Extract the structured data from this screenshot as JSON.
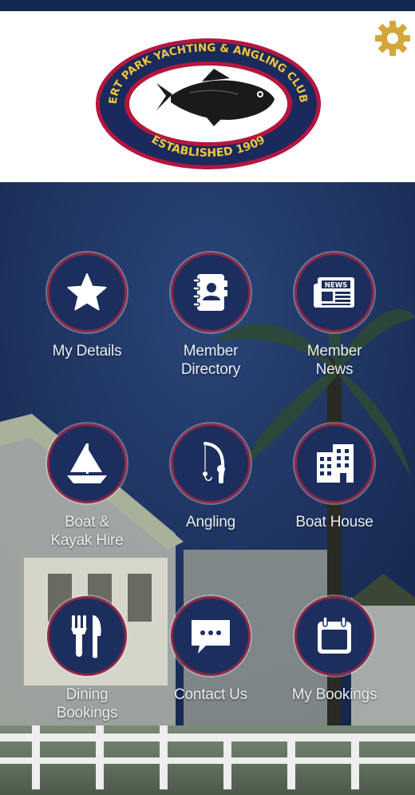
{
  "header": {
    "settings_icon": "gear-icon",
    "logo": {
      "top_text": "ALBERT PARK YACHTING & ANGLING CLUB INC",
      "bottom_text": "ESTABLISHED 1909"
    }
  },
  "colors": {
    "top_bar": "#152850",
    "gear": "#d4a63a",
    "circle_fill": "#1c2e5e",
    "circle_ring": "#8c2746"
  },
  "menu": {
    "tiles": [
      {
        "label": "My Details",
        "icon": "star-icon"
      },
      {
        "label": "Member\nDirectory",
        "icon": "address-book-icon"
      },
      {
        "label": "Member\nNews",
        "icon": "newspaper-icon"
      },
      {
        "label": "Boat &\nKayak Hire",
        "icon": "sailboat-icon"
      },
      {
        "label": "Angling",
        "icon": "fishing-rod-icon"
      },
      {
        "label": "Boat House",
        "icon": "building-icon"
      },
      {
        "label": "Dining\nBookings",
        "icon": "cutlery-icon"
      },
      {
        "label": "Contact Us",
        "icon": "chat-bubble-icon"
      },
      {
        "label": "My Bookings",
        "icon": "calendar-icon"
      }
    ]
  }
}
